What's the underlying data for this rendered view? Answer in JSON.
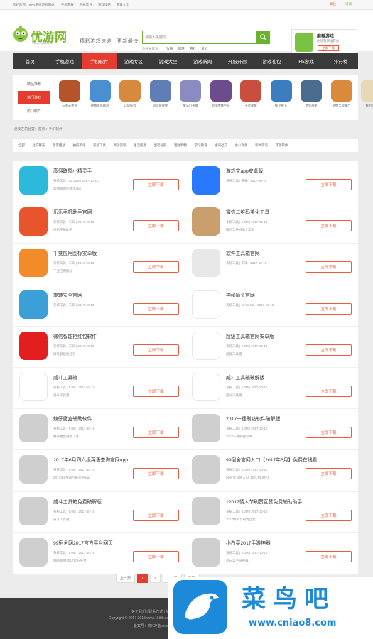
{
  "topbar": {
    "left": [
      "您好欢迎：99%系统游戏网站!",
      "手机游戏",
      "手机软件",
      "游戏攻略",
      "游戏大全"
    ],
    "right": [
      "关注",
      "订阅"
    ]
  },
  "header": {
    "logo_text": "优游网",
    "logo_url": "www.16ttttt.com",
    "slogan": "精彩游戏速递 · 更新最快",
    "search_placeholder": "请输入关键词",
    "hot_label": "热搜关键词：",
    "hot_words": [
      "攻略",
      "网游",
      "游戏",
      "单机"
    ],
    "promo_title": "麻辣游戏",
    "promo_sub": "你玩我来推荐你！",
    "promo_button": "立即下载"
  },
  "nav": {
    "items": [
      "首页",
      "手机游戏",
      "手机软件",
      "游戏专区",
      "游戏大全",
      "游戏新闻",
      "开服开测",
      "游戏礼包",
      "H5游戏",
      "排行榜"
    ],
    "active_index": 2
  },
  "categories": {
    "side": [
      "精品推荐",
      "热门游戏",
      "热门软件"
    ],
    "side_active": 1,
    "games": [
      {
        "name": "三国志手游",
        "color": "#b5532a",
        "sel": false
      },
      {
        "name": "神雕侠侣网游",
        "color": "#4a8fd1",
        "sel": false
      },
      {
        "name": "口袋妖怪",
        "color": "#d58a3e",
        "sel": false
      },
      {
        "name": "仙剑奇侠传",
        "color": "#5f7eb5",
        "sel": false
      },
      {
        "name": "魔法门英雄",
        "color": "#8b8bbf",
        "sel": false
      },
      {
        "name": "剑侠情缘手游",
        "color": "#6d4c8e",
        "sel": false
      },
      {
        "name": "王者荣耀",
        "color": "#c84f3e",
        "sel": false
      },
      {
        "name": "保卫萝卜",
        "color": "#3b7ebf",
        "sel": false
      },
      {
        "name": "皇室战争",
        "color": "#4b6b8f",
        "sel": true
      },
      {
        "name": "植物大战僵尸",
        "color": "#d98a3a",
        "sel": false
      },
      {
        "name": "我的世界",
        "color": "#e7d9b8",
        "sel": false
      }
    ]
  },
  "breadcrumb": "您现在的位置：首页 > 手机软件",
  "tags": [
    "全部",
    "社交聊天",
    "影音播放",
    "拍照美化",
    "系统工具",
    "阅读资讯",
    "生活服务",
    "出行导航",
    "理财购物",
    "学习教育",
    "通讯社交",
    "办公商务",
    "新闻资讯",
    "其他软件"
  ],
  "apps": [
    {
      "title": "高佣联盟小精灵手",
      "meta": "系统工具 | 25.13M | 2017-10-10",
      "desc": "高佣联盟小精灵app",
      "color": "#2db9dc"
    },
    {
      "title": "游戏宝app安卓版",
      "meta": "系统工具 | 未知 | 2017-10-10",
      "desc": "",
      "color": "#2979ff"
    },
    {
      "title": "乐乐手机助手官网",
      "meta": "系统工具 | 未知 | 2017-10-10",
      "desc": "乐乐手机助手",
      "color": "#e8542c"
    },
    {
      "title": "微信二维码美化工具",
      "meta": "系统工具 | 5.0M | 2017-10-10",
      "desc": "微信二维码美化工具",
      "color": "#c9a06d"
    },
    {
      "title": "千变应用图标安卓版",
      "meta": "系统工具 | 未知 | 2017-10-10",
      "desc": "千变应用图标",
      "color": "#f28c28"
    },
    {
      "title": "软件工具箱官网",
      "meta": "系统工具 | 未知 | 2017-10-10",
      "desc": "",
      "color": "#e8e8e8"
    },
    {
      "title": "旋转安全官网",
      "meta": "系统工具 | 未知 | 2017-10-10",
      "desc": "",
      "color": "#3b9fd8"
    },
    {
      "title": "神秘箭头官网",
      "meta": "系统工具 | 12.85 Ma | 2017-10-10",
      "desc": "",
      "color": "#ffffff"
    },
    {
      "title": "微信智能抢红包软件",
      "meta": "系统工具 | 未知 | 2017-10-10",
      "desc": "微信智能抢红包",
      "color": "#e21e1e"
    },
    {
      "title": "超级工具箱官网安卓版",
      "meta": "系统工具 | 5.0M | 2017-10-10",
      "desc": "超级工具箱",
      "color": "#ffffff"
    },
    {
      "title": "威斗工具箱",
      "meta": "系统工具 | 5.0M | 2017-10-10",
      "desc": "威斗工具箱",
      "color": "#ffffff"
    },
    {
      "title": "威斗工具箱破解版",
      "meta": "系统工具 | 5.0M | 2017-10-10",
      "desc": "威斗工具箱",
      "color": "#ffffff"
    },
    {
      "title": "魅仔魔盒辅助软件",
      "meta": "系统工具 | 5.0M | 2017-10-10",
      "desc": "魅仔魔盒辅助工具",
      "color": "#cfcfcf"
    },
    {
      "title": "2017一键刷钻软件破解版",
      "meta": "系统工具 | 5.0M | 2017-10-10",
      "desc": "2017一键刷钻软件",
      "color": "#cfcfcf"
    },
    {
      "title": "2017年6月四六级英语查询官网app",
      "meta": "系统工具 | 5.0M | 2017-10-10",
      "desc": "2017年6月四六级英语app",
      "color": "#cfcfcf"
    },
    {
      "title": "99宿舍官网入口【2017年6月】免费在线看",
      "meta": "系统工具 | 5.0M | 2017-10-10",
      "desc": "99宿舍官网入口【2017年6月】",
      "color": "#cfcfcf"
    },
    {
      "title": "威斗工具箱免费破解版",
      "meta": "系统工具 | 5.0M | 2017-10-10",
      "desc": "威斗工具箱",
      "color": "#cfcfcf"
    },
    {
      "title": "12017情人节刷赞互赞免费辅助助手",
      "meta": "系统工具 | 5.0M | 2017-10-10",
      "desc": "2017情人节刷赞互赞",
      "color": "#cfcfcf"
    },
    {
      "title": "99宿舍网2017官方平台网页",
      "meta": "系统工具 | 5.0M | 2017-10-10",
      "desc": "99宿舍网2017官方平台",
      "color": "#cfcfcf"
    },
    {
      "title": "小白菜2017手游神器",
      "meta": "系统工具 | 5.0M | 2017-10-10",
      "desc": "小白菜手游神器",
      "color": "#cfcfcf"
    }
  ],
  "download_label": "立即下载",
  "pager": [
    "上一页",
    "1",
    "2",
    "下一页",
    "尾页"
  ],
  "footer": {
    "line1": "关于我们 | 联系方式 | 版权声明",
    "line2": "Copyright © 2017-2018 www.16ttttt.com All Rights Reserved",
    "line3": "备案号：粤ICP备xxxxxxxx号"
  },
  "watermark": {
    "cn": "菜鸟吧",
    "en": "www.cniao8.com"
  }
}
